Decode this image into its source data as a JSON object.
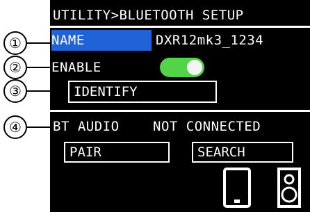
{
  "header": {
    "title": "UTILITY>BLUETOOTH SETUP"
  },
  "name_row": {
    "label": "NAME",
    "value": "DXR12mk3_1234"
  },
  "enable_row": {
    "label": "ENABLE",
    "enabled": true
  },
  "identify_button": {
    "label": "IDENTIFY"
  },
  "bt_audio": {
    "label": "BT AUDIO",
    "status": "NOT CONNECTED"
  },
  "pair_button": {
    "label": "PAIR"
  },
  "search_button": {
    "label": "SEARCH"
  },
  "icons": {
    "phone": "smartphone-icon",
    "speaker": "speaker-icon"
  },
  "callouts": [
    "①",
    "②",
    "③",
    "④"
  ],
  "colors": {
    "screen_bg": "#000000",
    "highlight": "#1f63d6",
    "toggle_on": "#52d34a"
  }
}
